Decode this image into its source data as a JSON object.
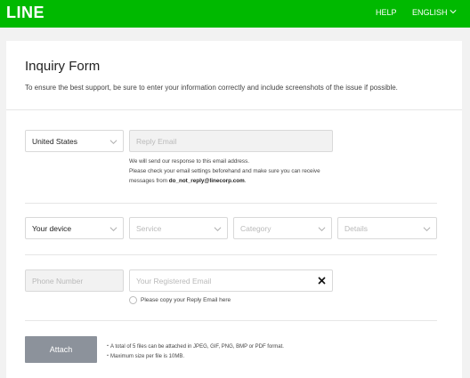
{
  "header": {
    "logo": "LINE",
    "help": "HELP",
    "language": "ENGLISH"
  },
  "form": {
    "title": "Inquiry Form",
    "subtitle": "To ensure the best support, be sure to enter your information correctly and include screenshots of the issue if possible.",
    "country": "United States",
    "reply_email_placeholder": "Reply Email",
    "reply_email_help_1": "We will send our response to this email address.",
    "reply_email_help_2": "Please check your email settings beforehand and make sure you can receive",
    "reply_email_help_3_prefix": "messages from ",
    "reply_email_help_3_email": "do_not_reply@linecorp.com",
    "reply_email_help_3_suffix": ".",
    "device": "Your device",
    "service_placeholder": "Service",
    "category_placeholder": "Category",
    "details_placeholder": "Details",
    "phone_placeholder": "Phone Number",
    "registered_email_placeholder": "Your Registered Email",
    "copy_reply_label": "Please copy your Reply Email here",
    "attach_label": "Attach",
    "attach_note_1": "・A total of 5 files can be attached in JPEG, GIF, PNG, BMP or PDF format.",
    "attach_note_2": "・Maximum size per file is 10MB."
  },
  "colors": {
    "brand": "#00b900",
    "attach_button": "#8c929b"
  }
}
